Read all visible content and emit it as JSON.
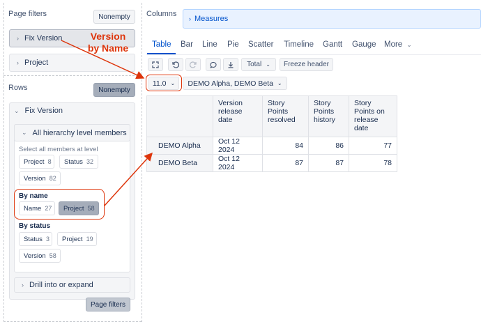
{
  "page_filters": {
    "title": "Page filters",
    "nonempty_label": "Nonempty",
    "items": [
      {
        "label": "Fix Version"
      },
      {
        "label": "Project"
      }
    ]
  },
  "rows": {
    "title": "Rows",
    "nonempty_label": "Nonempty",
    "dimension": "Fix Version",
    "hierarchy_label": "All hierarchy level members",
    "select_all_text": "Select all members at level",
    "level_chips": [
      {
        "name": "Project",
        "count": "8"
      },
      {
        "name": "Status",
        "count": "32"
      },
      {
        "name": "Version",
        "count": "82"
      }
    ],
    "by_name_label": "By name",
    "by_name_chips": [
      {
        "name": "Name",
        "count": "27"
      },
      {
        "name": "Project",
        "count": "58"
      }
    ],
    "by_status_label": "By status",
    "by_status_chips": [
      {
        "name": "Status",
        "count": "3"
      },
      {
        "name": "Project",
        "count": "19"
      },
      {
        "name": "Version",
        "count": "58"
      }
    ],
    "drill_label": "Drill into or expand",
    "page_filters_button": "Page filters"
  },
  "columns": {
    "title": "Columns",
    "measures_label": "Measures"
  },
  "tabs": [
    "Table",
    "Bar",
    "Line",
    "Pie",
    "Scatter",
    "Timeline",
    "Gantt",
    "Gauge",
    "More"
  ],
  "active_tab": "Table",
  "toolbar": {
    "total_label": "Total",
    "freeze_label": "Freeze header"
  },
  "filters": {
    "version_value": "11.0",
    "projects_value": "DEMO Alpha, DEMO Beta"
  },
  "table": {
    "headers": [
      "Version release date",
      "Story Points resolved",
      "Story Points history",
      "Story Points on release date"
    ],
    "rows": [
      {
        "name": "DEMO Alpha",
        "date": "Oct 12 2024",
        "resolved": "84",
        "history": "86",
        "on_release": "77"
      },
      {
        "name": "DEMO Beta",
        "date": "Oct 12 2024",
        "resolved": "87",
        "history": "87",
        "on_release": "78"
      }
    ]
  },
  "annotation": {
    "line1": "Version",
    "line2": "by Name",
    "color": "#de350b"
  },
  "colors": {
    "accent": "#0052cc",
    "annotation": "#de350b"
  }
}
